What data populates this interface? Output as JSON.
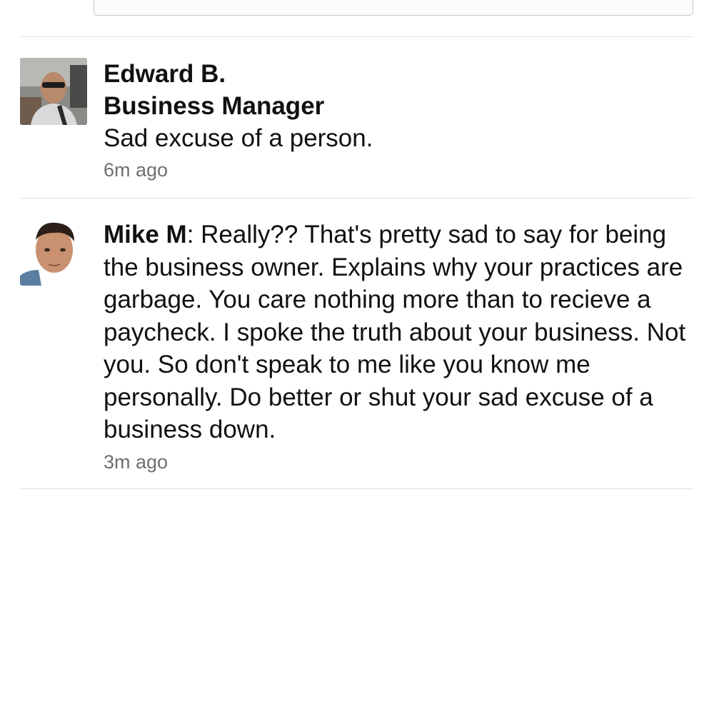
{
  "reply_box": {
    "placeholder": ""
  },
  "comments": [
    {
      "author": "Edward B.",
      "role": "Business Manager",
      "text": "Sad excuse of a person.",
      "time": "6m ago",
      "avatar": "profile-photo-man-sunglasses-car"
    },
    {
      "author": "Mike M",
      "separator": ": ",
      "text": "Really?? That's pretty sad to say for being the business owner. Explains why your practices are garbage. You care nothing more than to recieve a paycheck. I spoke the truth about your business. Not you. So don't speak to me like you know me personally. Do better or shut your sad excuse of a business down.",
      "time": "3m ago",
      "avatar": "profile-photo-man-selfie"
    }
  ],
  "colors": {
    "text": "#111111",
    "timestamp": "#6f6f6f",
    "divider": "#e4e4e4"
  }
}
